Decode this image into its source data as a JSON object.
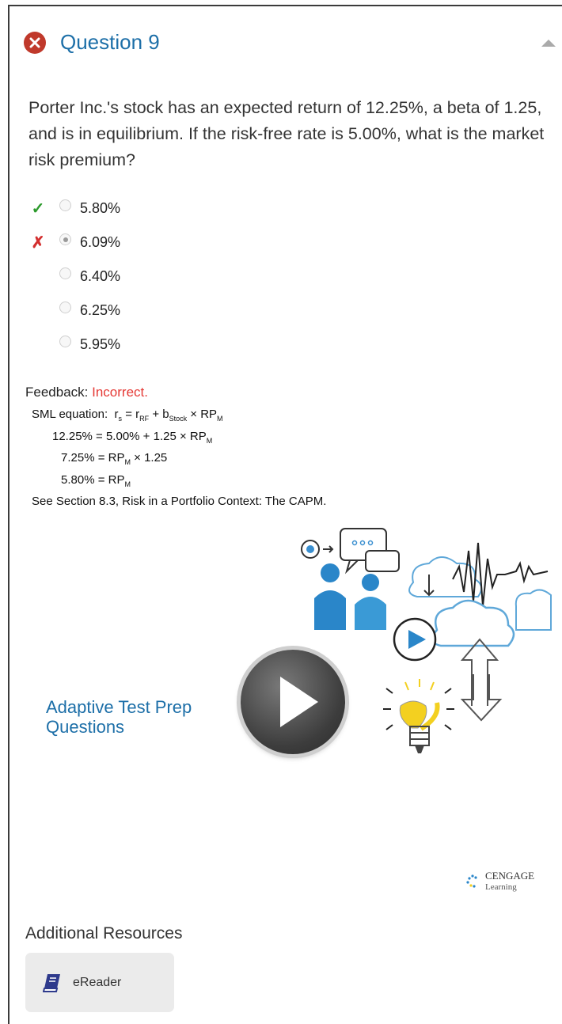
{
  "question": {
    "title": "Question 9",
    "status_icon": "x-circle-icon",
    "text": "Porter Inc.'s stock has an expected return of 12.25%, a beta of 1.25, and is in equilibrium. If the risk-free rate is 5.00%, what is the market risk premium?",
    "options": [
      {
        "label": "5.80%",
        "mark": "✓",
        "selected": false,
        "state": "correct"
      },
      {
        "label": "6.09%",
        "mark": "✗",
        "selected": true,
        "state": "incorrect"
      },
      {
        "label": "6.40%",
        "mark": "",
        "selected": false,
        "state": "none"
      },
      {
        "label": "6.25%",
        "mark": "",
        "selected": false,
        "state": "none"
      },
      {
        "label": "5.95%",
        "mark": "",
        "selected": false,
        "state": "none"
      }
    ]
  },
  "feedback": {
    "label": "Feedback:",
    "status": "Incorrect.",
    "sml_prefix": "SML equation:",
    "rs": "r",
    "rs_sub": "s",
    "eq1": "= r",
    "eq1_sub": "RF",
    "eq1b": "+ b",
    "eq1b_sub": "Stock",
    "eq1c": "× RP",
    "eq1c_sub": "M",
    "line2a": "12.25% = 5.00% + 1.25 × RP",
    "line2_sub": "M",
    "line3a": "7.25% = RP",
    "line3_sub": "M",
    "line3b": "× 1.25",
    "line4a": "5.80% = RP",
    "line4_sub": "M",
    "see_section": "See Section 8.3, Risk in a Portfolio Context: The CAPM."
  },
  "promo": {
    "line1": "Adaptive Test Prep",
    "line2": "Questions",
    "brand_line1": "CENGAGE",
    "brand_line2": "Learning"
  },
  "resources": {
    "heading": "Additional Resources",
    "ereader_label": "eReader"
  },
  "colors": {
    "accent": "#1d6fa8",
    "error": "#e53935",
    "correct": "#2c9a2c",
    "bulb": "#f3d020"
  }
}
